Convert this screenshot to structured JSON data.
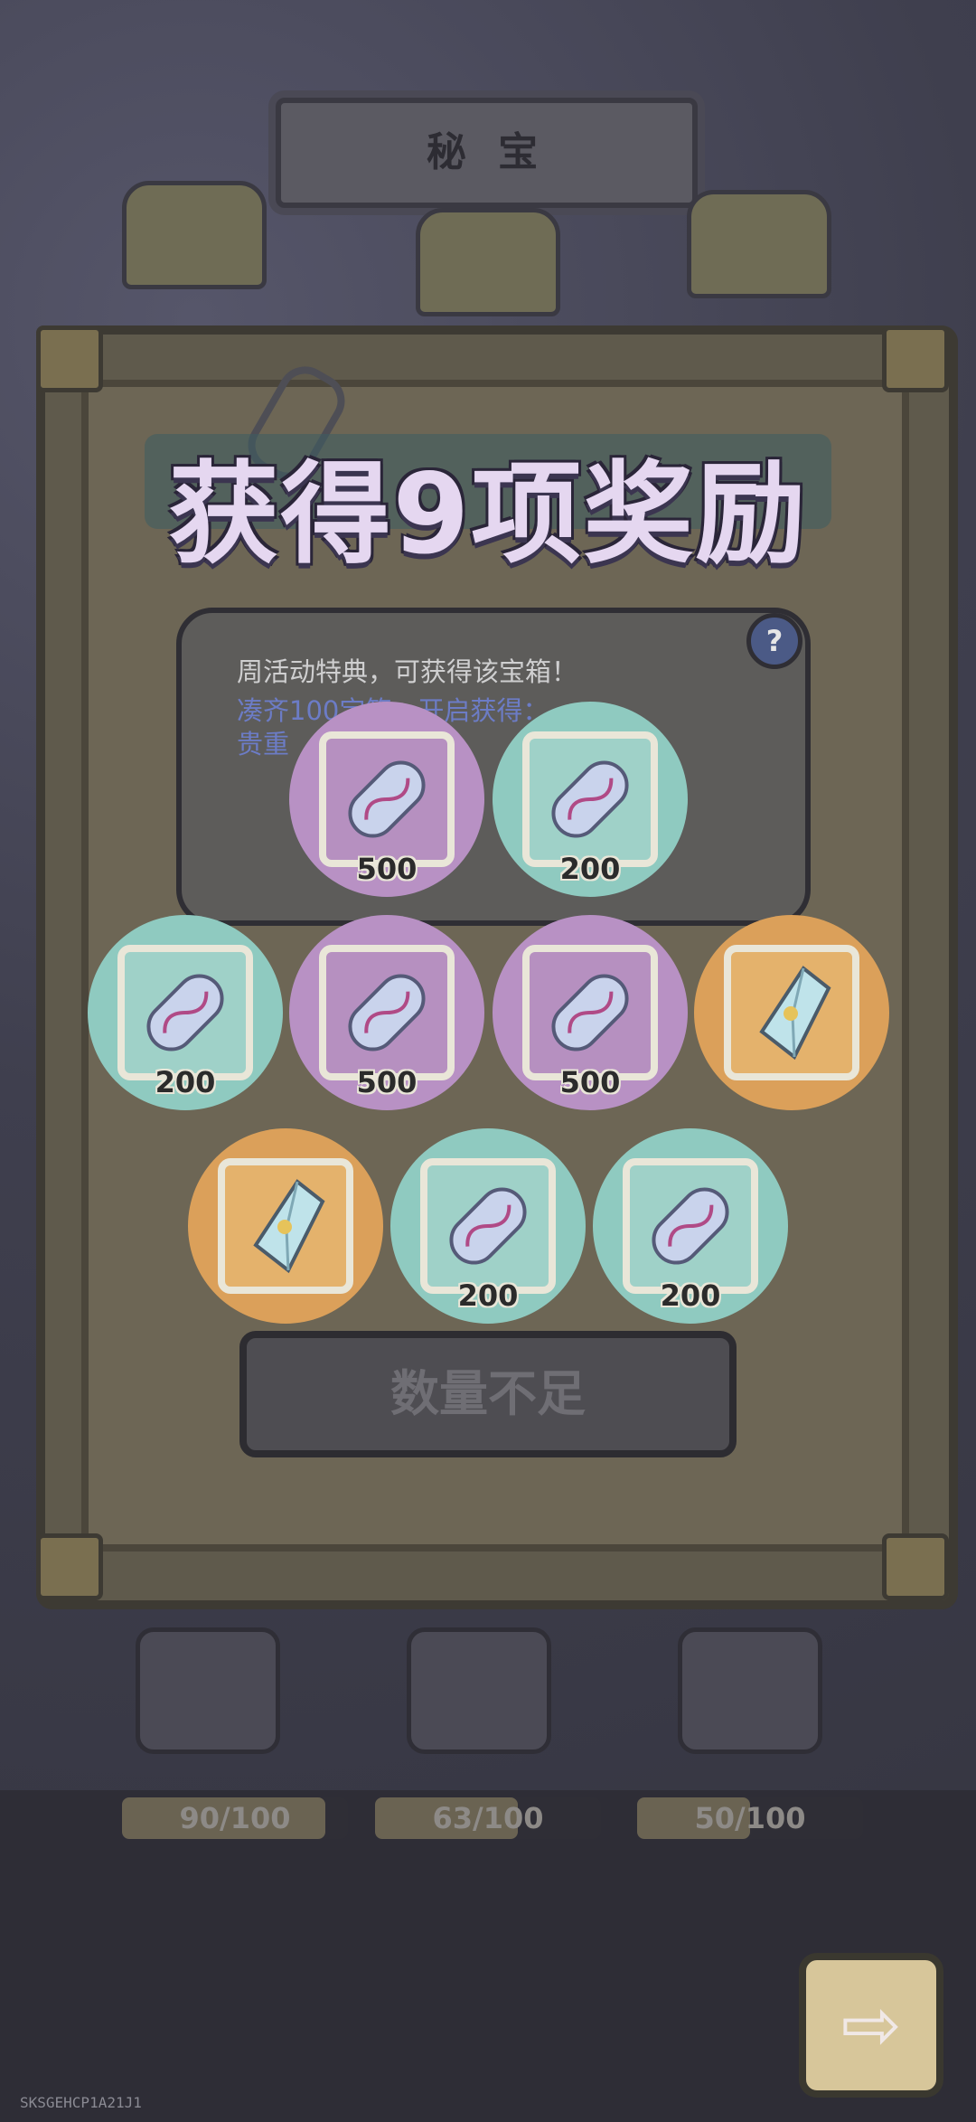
{
  "top_sign": {
    "label": "秘 宝"
  },
  "headline": "获得9项奖励",
  "info_panel": {
    "line1": "周活动特典，可获得该宝箱！",
    "line2": "凑齐100宝箱，开启获得：",
    "line3": "贵重",
    "help_icon": "?"
  },
  "rewards": [
    {
      "quantity": "500",
      "color": "purple",
      "icon": "crystal-capsule-icon"
    },
    {
      "quantity": "200",
      "color": "teal",
      "icon": "crystal-capsule-icon"
    },
    {
      "quantity": "200",
      "color": "teal",
      "icon": "crystal-capsule-icon"
    },
    {
      "quantity": "500",
      "color": "purple",
      "icon": "crystal-capsule-icon"
    },
    {
      "quantity": "500",
      "color": "purple",
      "icon": "crystal-capsule-icon"
    },
    {
      "quantity": "",
      "color": "orange",
      "icon": "crystal-shard-icon"
    },
    {
      "quantity": "",
      "color": "orange",
      "icon": "crystal-shard-icon"
    },
    {
      "quantity": "200",
      "color": "teal",
      "icon": "crystal-capsule-icon"
    },
    {
      "quantity": "200",
      "color": "teal",
      "icon": "crystal-capsule-icon"
    }
  ],
  "action_button": {
    "label": "数量不足"
  },
  "progress": [
    {
      "label": "90/100",
      "value": 0.9
    },
    {
      "label": "63/100",
      "value": 0.63
    },
    {
      "label": "50/100",
      "value": 0.5
    }
  ],
  "next_button": {
    "icon": "right-arrow-icon",
    "glyph": "⇨"
  },
  "device_id": "SKSGEHCP1A21J1",
  "colors": {
    "purple": "#b891c4",
    "teal": "#8fcac0",
    "orange": "#dba05a"
  }
}
